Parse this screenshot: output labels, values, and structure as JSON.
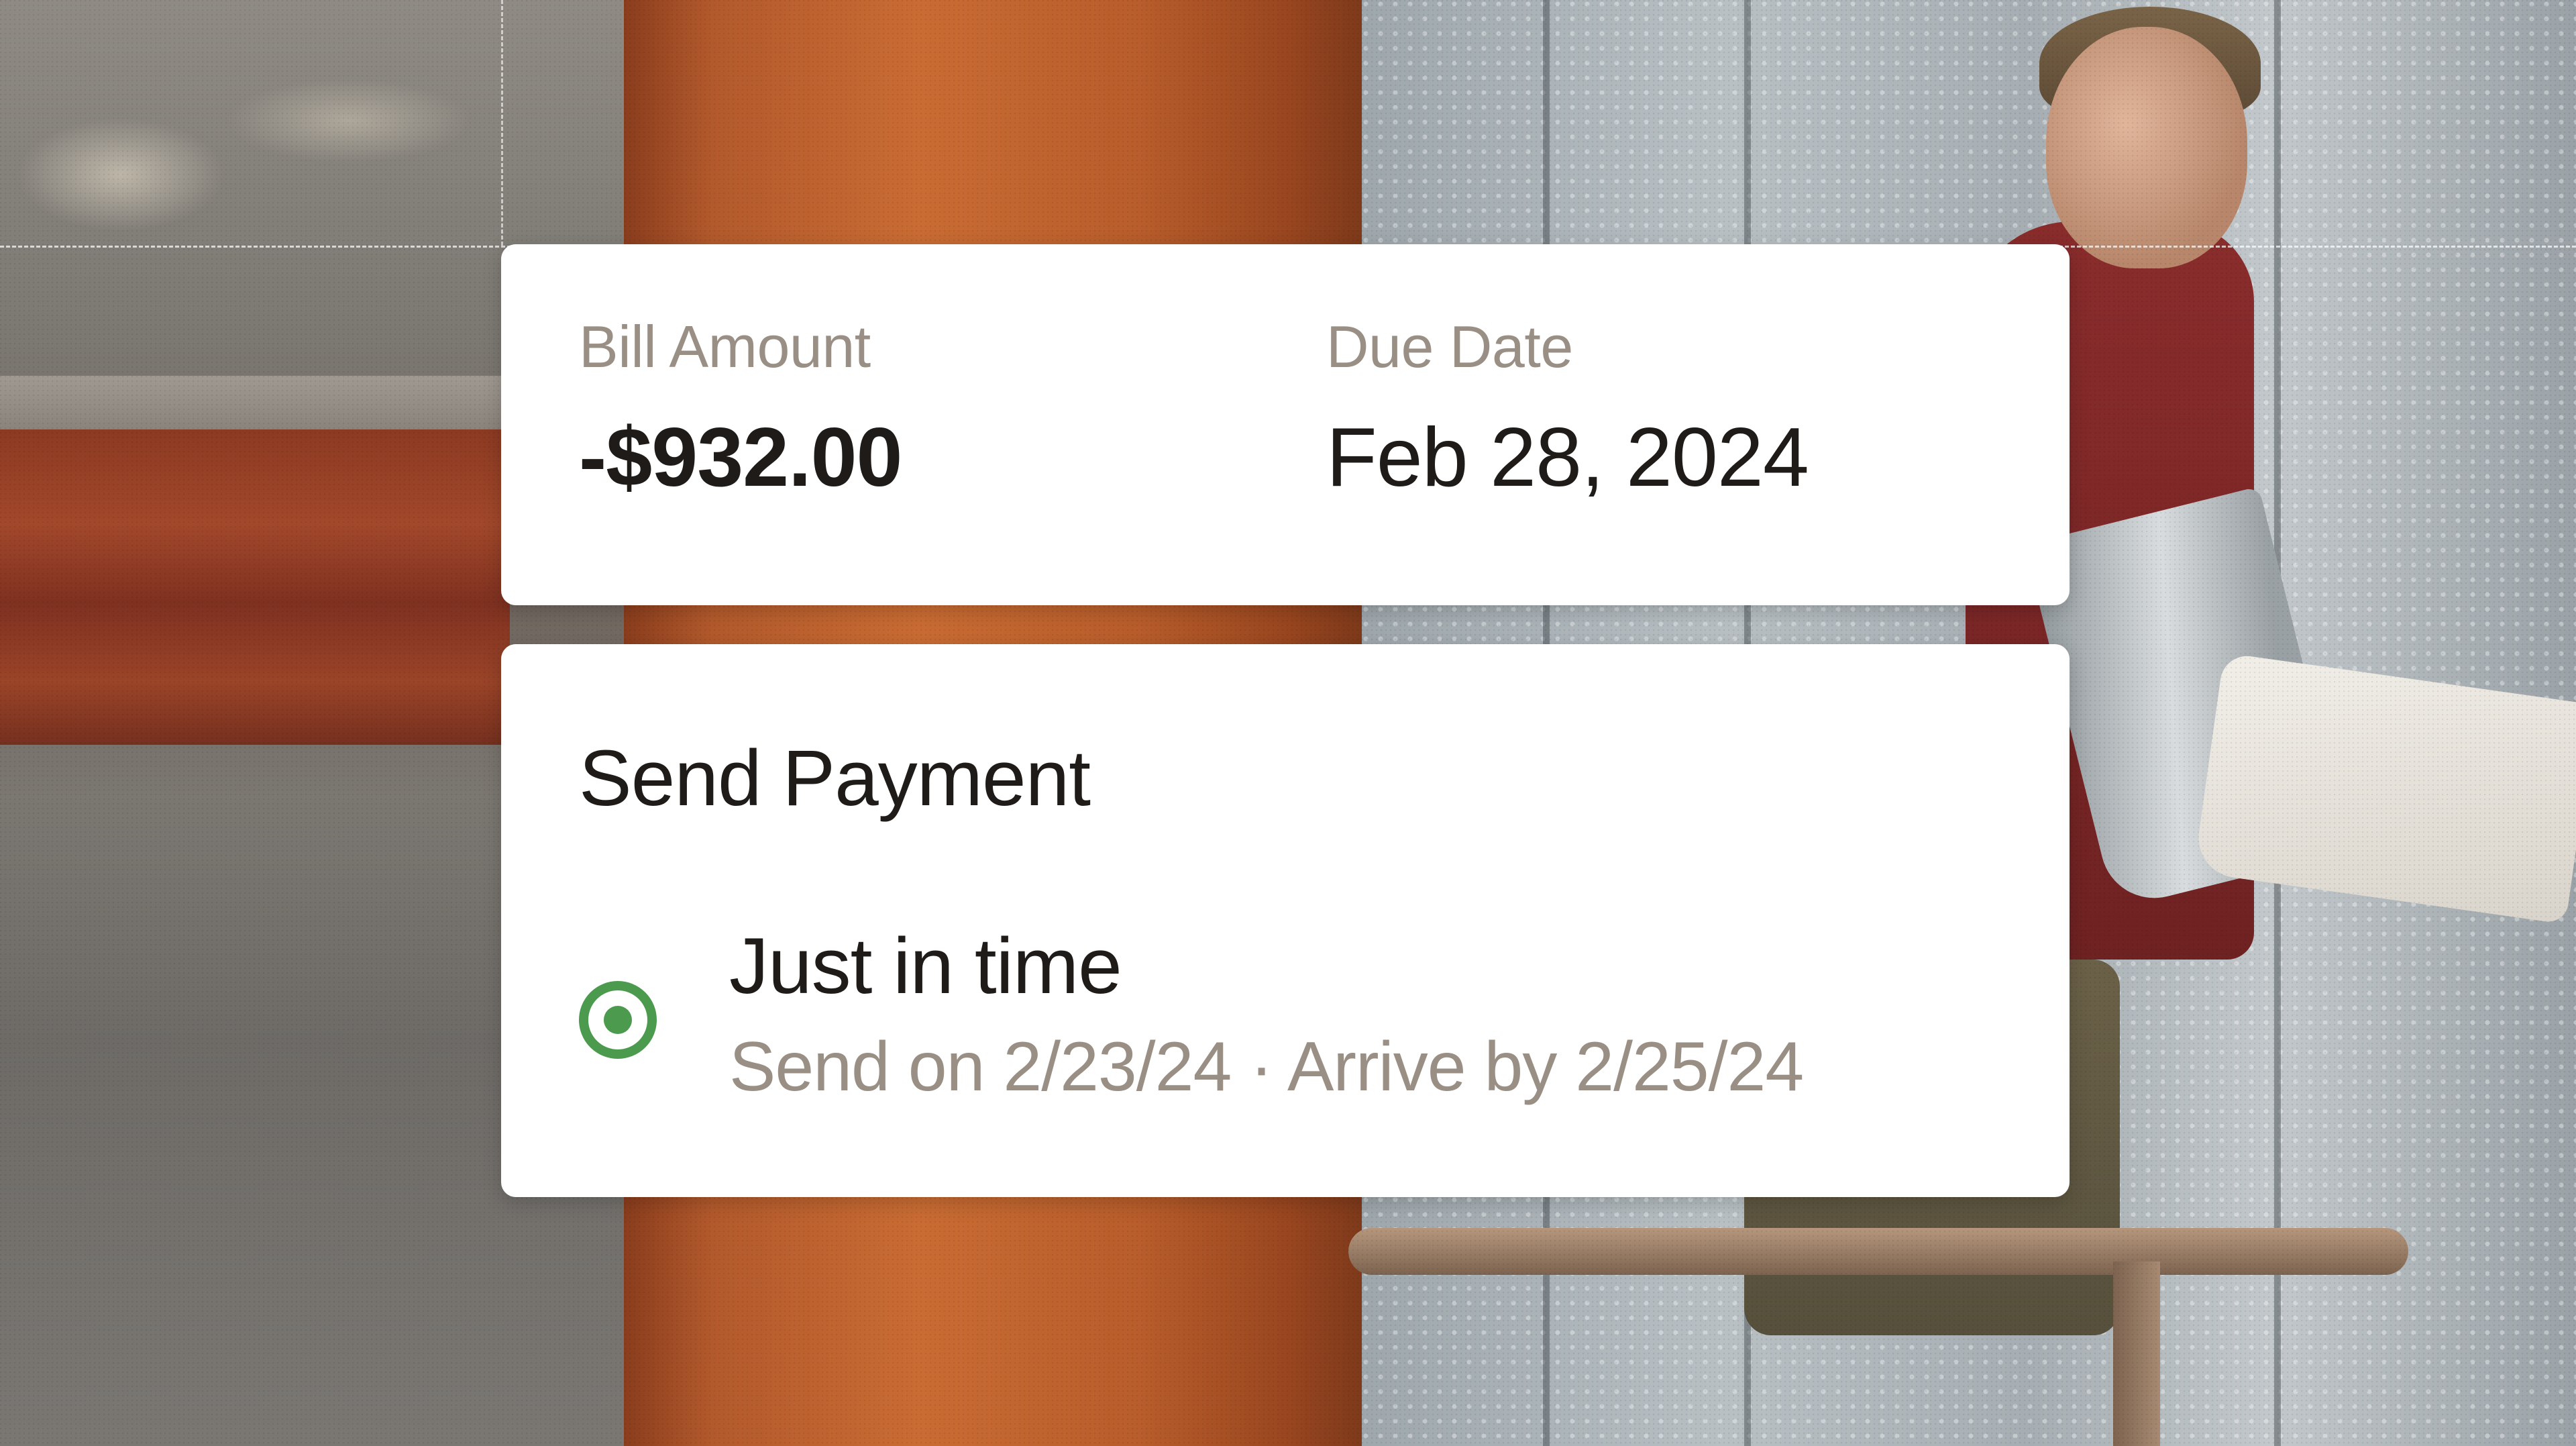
{
  "bill": {
    "amount_label": "Bill Amount",
    "amount_value": "-$932.00",
    "due_label": "Due Date",
    "due_value": "Feb 28, 2024"
  },
  "payment": {
    "title": "Send Payment",
    "option": {
      "title": "Just in time",
      "subtitle": "Send on 2/23/24 · Arrive by 2/25/24",
      "selected": true
    }
  },
  "colors": {
    "accent_green": "#4b9a4e",
    "muted_text": "#9a8f85",
    "primary_text": "#1f1b19",
    "card_bg": "#ffffff"
  },
  "icons": {
    "radio": "radio-selected-icon"
  }
}
